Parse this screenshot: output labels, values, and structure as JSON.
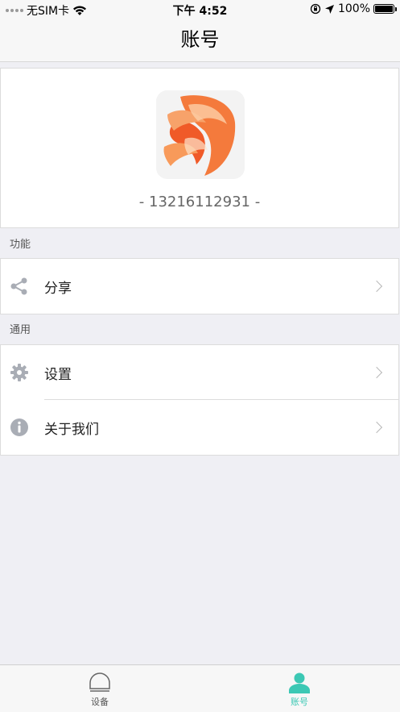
{
  "status_bar": {
    "carrier": "无SIM卡",
    "time": "下午 4:52",
    "battery_percent": "100%"
  },
  "nav": {
    "title": "账号"
  },
  "profile": {
    "phone": "- 13216112931 -",
    "avatar_icon": "betta-fish-avatar"
  },
  "sections": {
    "features": {
      "header": "功能",
      "items": [
        {
          "label": "分享",
          "icon": "share-icon"
        }
      ]
    },
    "general": {
      "header": "通用",
      "items": [
        {
          "label": "设置",
          "icon": "gear-icon"
        },
        {
          "label": "关于我们",
          "icon": "info-icon"
        }
      ]
    }
  },
  "tab_bar": {
    "tabs": [
      {
        "label": "设备",
        "icon": "device-icon",
        "active": false
      },
      {
        "label": "账号",
        "icon": "person-icon",
        "active": true
      }
    ]
  },
  "colors": {
    "accent": "#3cc8b4",
    "icon_gray": "#a9adb5",
    "background": "#efeff4"
  }
}
